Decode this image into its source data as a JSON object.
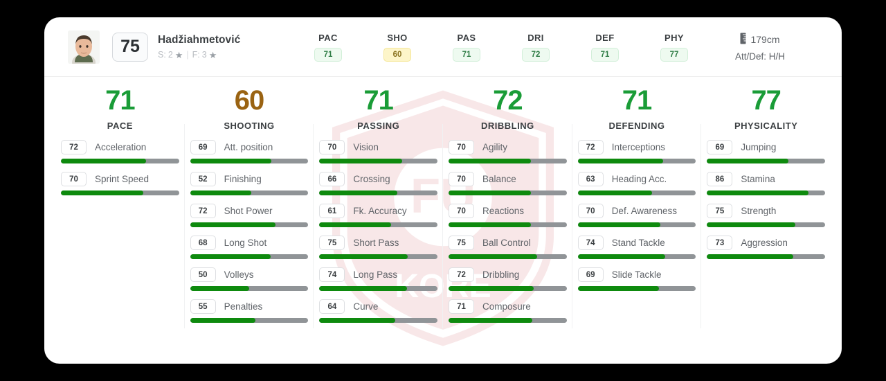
{
  "player": {
    "name": "Hadžiahmetović",
    "overall": "75",
    "skill_label": "S:",
    "skill_moves": "2",
    "weak_foot_label": "F:",
    "weak_foot": "3",
    "star_glyph": "★",
    "separator": "|",
    "height": "179cm",
    "height_icon": "ruler-icon",
    "work_rate": "Att/Def: H/H"
  },
  "top_attributes": [
    {
      "label": "PAC",
      "value": "71",
      "style": "green"
    },
    {
      "label": "SHO",
      "value": "60",
      "style": "yellow"
    },
    {
      "label": "PAS",
      "value": "71",
      "style": "green"
    },
    {
      "label": "DRI",
      "value": "72",
      "style": "green"
    },
    {
      "label": "DEF",
      "value": "71",
      "style": "green"
    },
    {
      "label": "PHY",
      "value": "77",
      "style": "green"
    }
  ],
  "colors": {
    "score_green": "#1a9c37",
    "score_bronze": "#9a6312",
    "bar_fill": "#0e8a0e",
    "bar_track": "#909497",
    "card_bg": "#ffffff",
    "page_bg": "#000000"
  },
  "categories": [
    {
      "name": "PACE",
      "score": "71",
      "score_color": "#1a9c37",
      "stats": [
        {
          "name": "Acceleration",
          "value": "72"
        },
        {
          "name": "Sprint Speed",
          "value": "70"
        }
      ]
    },
    {
      "name": "SHOOTING",
      "score": "60",
      "score_color": "#9a6312",
      "stats": [
        {
          "name": "Att. position",
          "value": "69"
        },
        {
          "name": "Finishing",
          "value": "52"
        },
        {
          "name": "Shot Power",
          "value": "72"
        },
        {
          "name": "Long Shot",
          "value": "68"
        },
        {
          "name": "Volleys",
          "value": "50"
        },
        {
          "name": "Penalties",
          "value": "55"
        }
      ]
    },
    {
      "name": "PASSING",
      "score": "71",
      "score_color": "#1a9c37",
      "stats": [
        {
          "name": "Vision",
          "value": "70"
        },
        {
          "name": "Crossing",
          "value": "66"
        },
        {
          "name": "Fk. Accuracy",
          "value": "61"
        },
        {
          "name": "Short Pass",
          "value": "75"
        },
        {
          "name": "Long Pass",
          "value": "74"
        },
        {
          "name": "Curve",
          "value": "64"
        }
      ]
    },
    {
      "name": "DRIBBLING",
      "score": "72",
      "score_color": "#1a9c37",
      "stats": [
        {
          "name": "Agility",
          "value": "70"
        },
        {
          "name": "Balance",
          "value": "70"
        },
        {
          "name": "Reactions",
          "value": "70"
        },
        {
          "name": "Ball Control",
          "value": "75"
        },
        {
          "name": "Dribbling",
          "value": "72"
        },
        {
          "name": "Composure",
          "value": "71"
        }
      ]
    },
    {
      "name": "DEFENDING",
      "score": "71",
      "score_color": "#1a9c37",
      "stats": [
        {
          "name": "Interceptions",
          "value": "72"
        },
        {
          "name": "Heading Acc.",
          "value": "63"
        },
        {
          "name": "Def. Awareness",
          "value": "70"
        },
        {
          "name": "Stand Tackle",
          "value": "74"
        },
        {
          "name": "Slide Tackle",
          "value": "69"
        }
      ]
    },
    {
      "name": "PHYSICALITY",
      "score": "77",
      "score_color": "#1a9c37",
      "stats": [
        {
          "name": "Jumping",
          "value": "69"
        },
        {
          "name": "Stamina",
          "value": "86"
        },
        {
          "name": "Strength",
          "value": "75"
        },
        {
          "name": "Aggression",
          "value": "73"
        }
      ]
    }
  ]
}
